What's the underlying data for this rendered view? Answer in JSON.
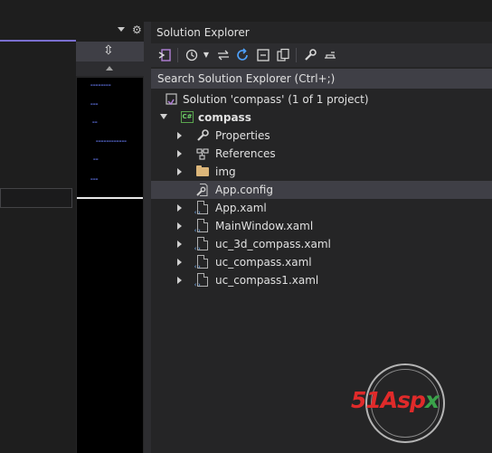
{
  "solution_explorer": {
    "title": "Solution Explorer",
    "search_placeholder": "Search Solution Explorer (Ctrl+;)",
    "solution_label": "Solution 'compass' (1 of 1 project)",
    "project": {
      "name": "compass",
      "icon": "csharp-project-icon"
    },
    "items": [
      {
        "label": "Properties",
        "icon": "wrench-icon",
        "expandable": true
      },
      {
        "label": "References",
        "icon": "references-icon",
        "expandable": true
      },
      {
        "label": "img",
        "icon": "folder-icon",
        "expandable": true
      },
      {
        "label": "App.config",
        "icon": "config-file-icon",
        "expandable": false,
        "selected": true
      },
      {
        "label": "App.xaml",
        "icon": "xaml-file-icon",
        "expandable": true
      },
      {
        "label": "MainWindow.xaml",
        "icon": "xaml-file-icon",
        "expandable": true
      },
      {
        "label": "uc_3d_compass.xaml",
        "icon": "xaml-file-icon",
        "expandable": true
      },
      {
        "label": "uc_compass.xaml",
        "icon": "xaml-file-icon",
        "expandable": true
      },
      {
        "label": "uc_compass1.xaml",
        "icon": "xaml-file-icon",
        "expandable": true
      }
    ],
    "toolbar_icons": [
      "switch-views-icon",
      "pending-changes-filter-icon",
      "sync-with-active-document-icon",
      "refresh-icon",
      "collapse-all-icon",
      "show-all-files-icon",
      "properties-wrench-icon",
      "preview-selected-items-icon"
    ]
  },
  "watermark": {
    "logo_text": "51Aspx",
    "colors": {
      "five_one": "#e02a2a",
      "asp": "#e02a2a",
      "x": "#3aa24a"
    }
  },
  "colors": {
    "accent": "#7a6fcf",
    "panel_bg": "#252526",
    "selected_row": "#3f3f46"
  }
}
